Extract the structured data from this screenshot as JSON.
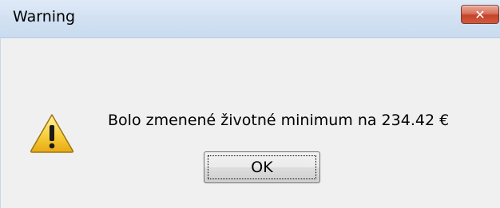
{
  "window": {
    "title": "Warning",
    "close_glyph": "✕"
  },
  "dialog": {
    "icon": "warning-icon",
    "message": "Bolo zmenené životné minimum na 234.42 €",
    "ok_label": "OK"
  },
  "colors": {
    "titlebar": "#d3e2f3",
    "client_bg": "#f0f0f0",
    "close_button": "#c6432b",
    "warning_yellow": "#f7d03b"
  }
}
